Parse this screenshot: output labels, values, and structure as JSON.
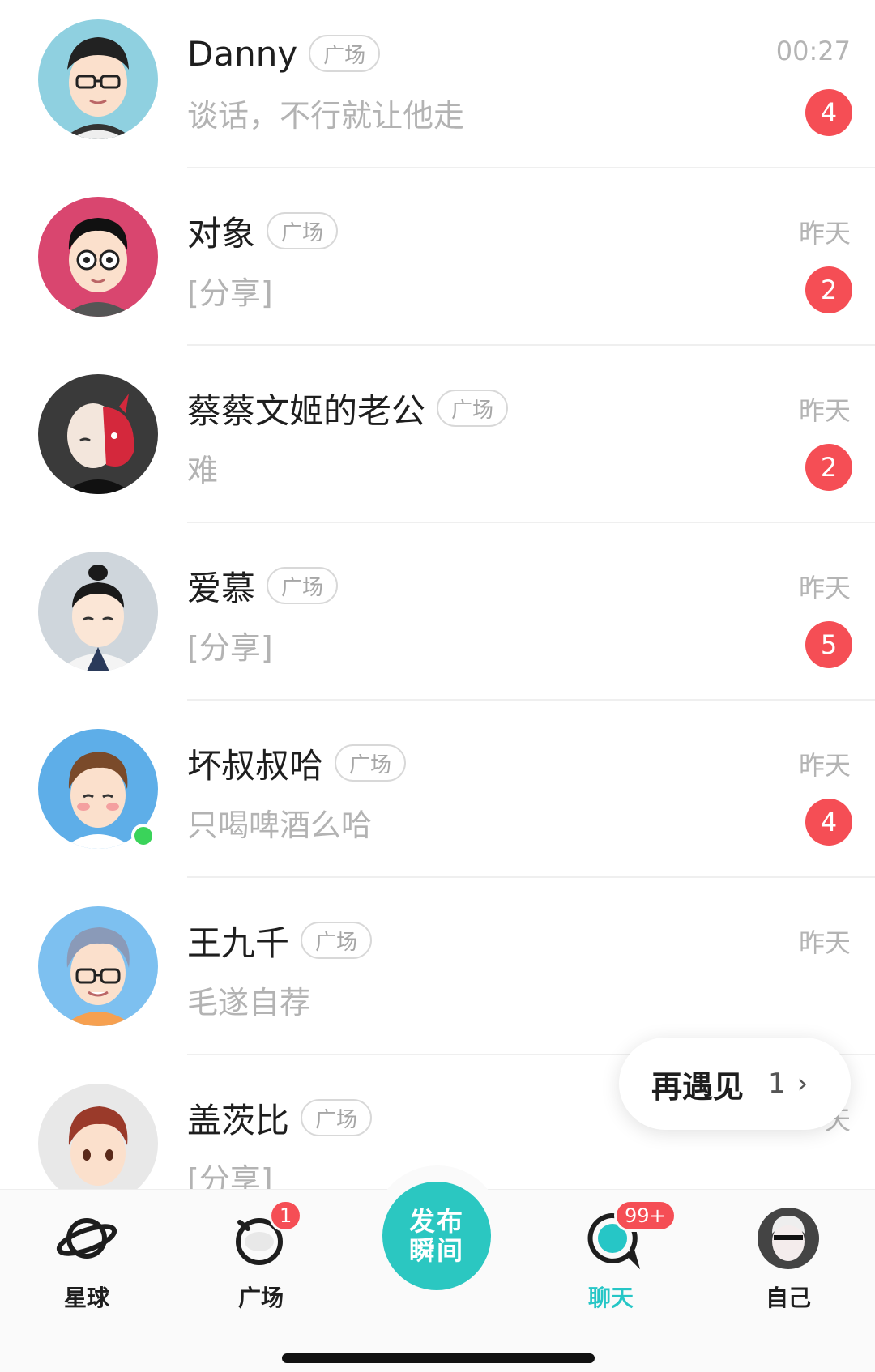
{
  "chats": [
    {
      "name": "Danny",
      "tag": "广场",
      "time": "00:27",
      "preview": "谈话，不行就让他走",
      "badge": "4",
      "avatar_bg": "#8fd0e0"
    },
    {
      "name": "对象",
      "tag": "广场",
      "time": "昨天",
      "preview": "[分享]",
      "badge": "2",
      "avatar_bg": "#d9466f"
    },
    {
      "name": "蔡蔡文姬的老公",
      "tag": "广场",
      "time": "昨天",
      "preview": "难",
      "badge": "2",
      "avatar_bg": "#3a3a3a"
    },
    {
      "name": "爱慕",
      "tag": "广场",
      "time": "昨天",
      "preview": "[分享]",
      "badge": "5",
      "avatar_bg": "#cfd6dc"
    },
    {
      "name": "坏叔叔哈",
      "tag": "广场",
      "time": "昨天",
      "preview": "只喝啤酒么哈",
      "badge": "4",
      "avatar_bg": "#5eaee8",
      "online": true
    },
    {
      "name": "王九千",
      "tag": "广场",
      "time": "昨天",
      "preview": "毛遂自荐",
      "avatar_bg": "#7dc0f0"
    },
    {
      "name": "盖茨比",
      "tag": "广场",
      "time": "天",
      "preview": "[分享]",
      "avatar_bg": "#e8e8e8"
    }
  ],
  "toast": {
    "title": "再遇见",
    "count": "1",
    "chevron": "›"
  },
  "tabbar": {
    "tabs": [
      {
        "label": "星球",
        "icon": "planet-icon"
      },
      {
        "label": "广场",
        "icon": "square-icon",
        "badge": "1"
      },
      {
        "label": "聊天",
        "icon": "chat-icon",
        "badge": "99+",
        "active": true
      },
      {
        "label": "自己",
        "icon": "profile-avatar"
      }
    ],
    "publish": {
      "line1": "发布",
      "line2": "瞬间"
    }
  },
  "colors": {
    "accent": "#2bc7c1",
    "badge": "#f54e55",
    "online": "#3ad35a"
  }
}
